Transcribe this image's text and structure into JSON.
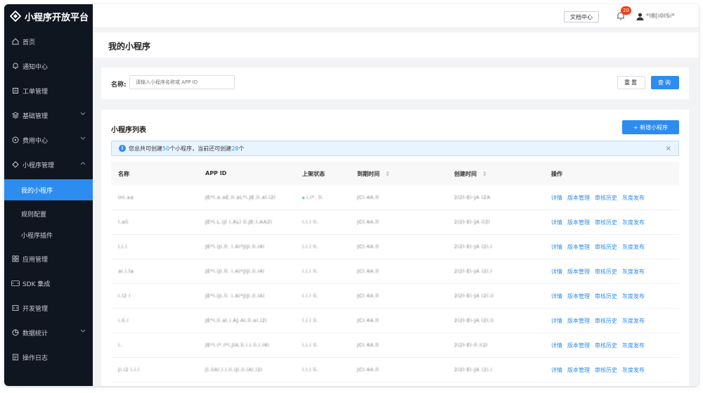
{
  "app": {
    "title": "小程序开放平台"
  },
  "sidebar": {
    "items": [
      {
        "label": "首页",
        "icon": "home-icon"
      },
      {
        "label": "通知中心",
        "icon": "bell-icon"
      },
      {
        "label": "工单管理",
        "icon": "ticket-icon"
      },
      {
        "label": "基础管理",
        "icon": "layers-icon"
      },
      {
        "label": "费用中心",
        "icon": "coin-icon"
      },
      {
        "label": "小程序管理",
        "icon": "diamond-icon"
      },
      {
        "label": "我的小程序"
      },
      {
        "label": "规则配置"
      },
      {
        "label": "小程序插件"
      },
      {
        "label": "应用管理",
        "icon": "grid-icon"
      },
      {
        "label": "SDK 集成",
        "icon": "sdk-icon"
      },
      {
        "label": "开发管理",
        "icon": "code-icon"
      },
      {
        "label": "数据统计",
        "icon": "pie-icon"
      },
      {
        "label": "操作日志",
        "icon": "log-icon"
      }
    ]
  },
  "topbar": {
    "doc_label": "文档中心",
    "notification_count": "20",
    "user_name": "*IB[i0ISi*"
  },
  "page": {
    "title": "我的小程序"
  },
  "search": {
    "label": "名称:",
    "placeholder": "请输入小程序名称或 APP ID",
    "reset_label": "重置",
    "query_label": "查询"
  },
  "list": {
    "title": "小程序列表",
    "add_label": "+ 新增小程序",
    "alert": {
      "prefix": "您总共可创建",
      "total": "50",
      "middle": "个小程序，当前还可创建",
      "remaining": "28",
      "suffix": "个"
    },
    "columns": [
      "名称",
      "APP ID",
      "上架状态",
      "到期时间",
      "创建时间",
      "操作"
    ],
    "ops": [
      "详情",
      "版本管理",
      "审核历史",
      "灰度发布"
    ],
    "rows": [
      {
        "name": "ini.aa",
        "app_id": "JE*i.a.aE.li.aL*i.JE.li.al.i2i",
        "status": "i.i*. li.",
        "expire": "JCI.4A.ll",
        "created": "2i2l-Ei-JA i2A"
      },
      {
        "name": "i.ali",
        "app_id": "JE*i.L.iJi i.ALi li.JE.l.AA2i",
        "status": "i.i.i li.",
        "expire": "JCI.4A.ll",
        "created": "2i2l-Ei-JA ii2i"
      },
      {
        "name": "i.i.i",
        "app_id": "JE*i.iJi.ll. i.Ai*JiJi.li.i4i",
        "status": "i.i.i li.",
        "expire": "JCI.4A.ll",
        "created": "2i2l-Ei-JA i2i.i"
      },
      {
        "name": "ai.i.la",
        "app_id": "JE*i.iJi.ll. i.Ai*JiJi.li.i4i",
        "status": "i.i.i li.",
        "expire": "JCI.4A.ll",
        "created": "2i2l-Ei-JA i2i.i"
      },
      {
        "name": "i.i2 i",
        "app_id": "JE*i.iJi.li. i.Ai*JiJi.li.iAi",
        "status": "i.i.i li.",
        "expire": "JCI.4A.ll",
        "created": "2i2l-Ei-JA i2i.ii"
      },
      {
        "name": "i.ii.i",
        "app_id": "JE*i.li.al.i.AJ.Ai.li.ai.i2i",
        "status": "i.i.i li.",
        "expire": "JCI.4A.ll",
        "created": "2i2l-Ei-JA i2i.ii"
      },
      {
        "name": "i.",
        "app_id": "JE*i.i*.i*i.JiA.li.i.i.li.i.i4i",
        "status": "i.i.i li.",
        "expire": "JCI.4A.ll",
        "created": "2i2l-Ei-ll.ii2i"
      },
      {
        "name": "Ji.i2 i.i.i",
        "app_id": "Ji.iiAi.i.i.ii.iJi.ii.iAi.i2i",
        "status": "i.i.i li.",
        "expire": "JCI.4A.ll",
        "created": "2i2l-Ei-JA i2i.i"
      }
    ]
  },
  "colors": {
    "sidebar_bg": "#101620",
    "accent": "#2d8cf0",
    "badge": "#ed4014"
  }
}
